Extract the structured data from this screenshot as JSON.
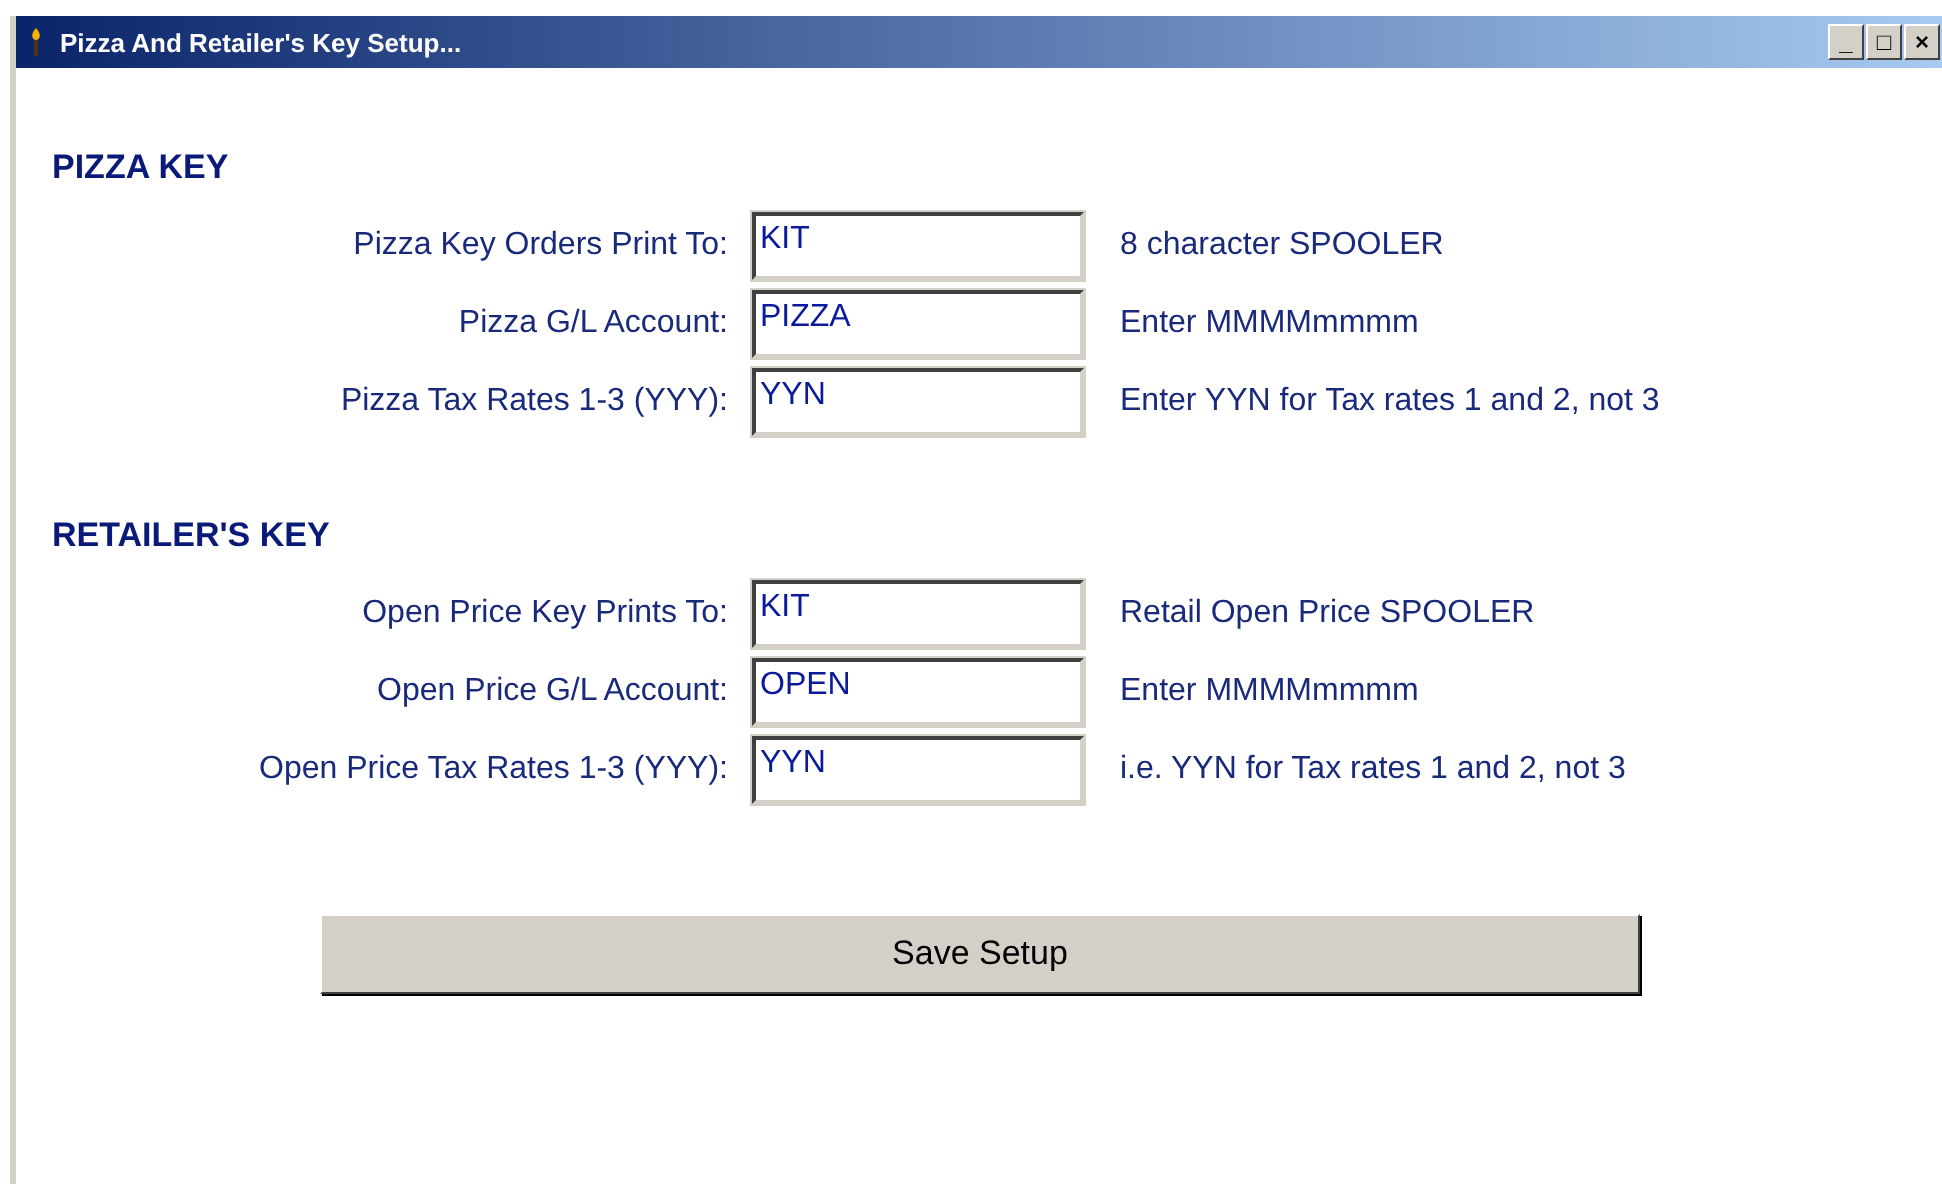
{
  "window": {
    "title": "Pizza And Retailer's Key Setup...",
    "controls": [
      "_",
      "□",
      "×"
    ]
  },
  "sections": [
    {
      "heading": "PIZZA KEY",
      "rows": [
        {
          "label": "Pizza Key Orders Print To:",
          "value": "KIT",
          "hint": "8 character SPOOLER"
        },
        {
          "label": "Pizza G/L Account:",
          "value": "PIZZA",
          "hint": "Enter MMMMmmmm"
        },
        {
          "label": "Pizza Tax Rates 1-3 (YYY):",
          "value": "YYN",
          "hint": "Enter YYN for Tax rates 1 and 2, not 3"
        }
      ]
    },
    {
      "heading": "RETAILER'S KEY",
      "rows": [
        {
          "label": "Open Price Key Prints To:",
          "value": "KIT",
          "hint": "Retail Open Price SPOOLER"
        },
        {
          "label": "Open Price G/L Account:",
          "value": "OPEN",
          "hint": "Enter MMMMmmmm"
        },
        {
          "label": "Open Price Tax Rates 1-3 (YYY):",
          "value": "YYN",
          "hint": "i.e. YYN for Tax rates 1 and 2, not 3"
        }
      ]
    }
  ],
  "save_button": "Save Setup"
}
